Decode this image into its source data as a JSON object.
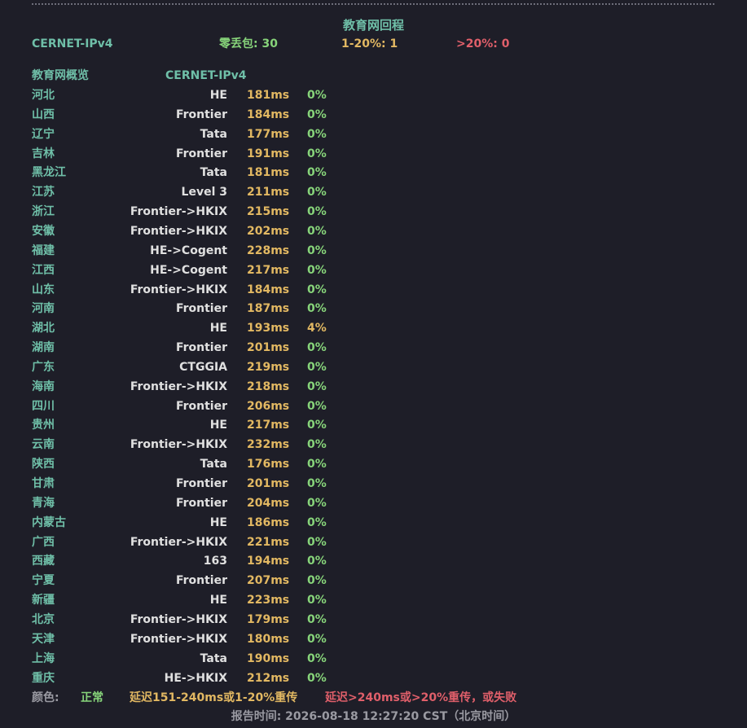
{
  "title": "教育网回程",
  "summary": {
    "network": "CERNET-IPv4",
    "zero_loss_label": "零丢包: 30",
    "mid_loss_label": "1-20%:  1",
    "high_loss_label": ">20%:  0"
  },
  "table": {
    "header_region": "教育网概览",
    "header_network": "CERNET-IPv4",
    "rows": [
      {
        "province": "河北",
        "isp": "HE",
        "latency": "181ms",
        "loss": "0%",
        "status": "normal"
      },
      {
        "province": "山西",
        "isp": "Frontier",
        "latency": "184ms",
        "loss": "0%",
        "status": "normal"
      },
      {
        "province": "辽宁",
        "isp": "Tata",
        "latency": "177ms",
        "loss": "0%",
        "status": "normal"
      },
      {
        "province": "吉林",
        "isp": "Frontier",
        "latency": "191ms",
        "loss": "0%",
        "status": "normal"
      },
      {
        "province": "黑龙江",
        "isp": "Tata",
        "latency": "181ms",
        "loss": "0%",
        "status": "normal"
      },
      {
        "province": "江苏",
        "isp": "Level 3",
        "latency": "211ms",
        "loss": "0%",
        "status": "normal"
      },
      {
        "province": "浙江",
        "isp": "Frontier->HKIX",
        "latency": "215ms",
        "loss": "0%",
        "status": "normal"
      },
      {
        "province": "安徽",
        "isp": "Frontier->HKIX",
        "latency": "202ms",
        "loss": "0%",
        "status": "normal"
      },
      {
        "province": "福建",
        "isp": "HE->Cogent",
        "latency": "228ms",
        "loss": "0%",
        "status": "normal"
      },
      {
        "province": "江西",
        "isp": "HE->Cogent",
        "latency": "217ms",
        "loss": "0%",
        "status": "normal"
      },
      {
        "province": "山东",
        "isp": "Frontier->HKIX",
        "latency": "184ms",
        "loss": "0%",
        "status": "normal"
      },
      {
        "province": "河南",
        "isp": "Frontier",
        "latency": "187ms",
        "loss": "0%",
        "status": "normal"
      },
      {
        "province": "湖北",
        "isp": "HE",
        "latency": "193ms",
        "loss": "4%",
        "status": "warn"
      },
      {
        "province": "湖南",
        "isp": "Frontier",
        "latency": "201ms",
        "loss": "0%",
        "status": "normal"
      },
      {
        "province": "广东",
        "isp": "CTGGIA",
        "latency": "219ms",
        "loss": "0%",
        "status": "normal"
      },
      {
        "province": "海南",
        "isp": "Frontier->HKIX",
        "latency": "218ms",
        "loss": "0%",
        "status": "normal"
      },
      {
        "province": "四川",
        "isp": "Frontier",
        "latency": "206ms",
        "loss": "0%",
        "status": "normal"
      },
      {
        "province": "贵州",
        "isp": "HE",
        "latency": "217ms",
        "loss": "0%",
        "status": "normal"
      },
      {
        "province": "云南",
        "isp": "Frontier->HKIX",
        "latency": "232ms",
        "loss": "0%",
        "status": "normal"
      },
      {
        "province": "陕西",
        "isp": "Tata",
        "latency": "176ms",
        "loss": "0%",
        "status": "normal"
      },
      {
        "province": "甘肃",
        "isp": "Frontier",
        "latency": "201ms",
        "loss": "0%",
        "status": "normal"
      },
      {
        "province": "青海",
        "isp": "Frontier",
        "latency": "204ms",
        "loss": "0%",
        "status": "normal"
      },
      {
        "province": "内蒙古",
        "isp": "HE",
        "latency": "186ms",
        "loss": "0%",
        "status": "normal"
      },
      {
        "province": "广西",
        "isp": "Frontier->HKIX",
        "latency": "221ms",
        "loss": "0%",
        "status": "normal"
      },
      {
        "province": "西藏",
        "isp": "163",
        "latency": "194ms",
        "loss": "0%",
        "status": "normal"
      },
      {
        "province": "宁夏",
        "isp": "Frontier",
        "latency": "207ms",
        "loss": "0%",
        "status": "normal"
      },
      {
        "province": "新疆",
        "isp": "HE",
        "latency": "223ms",
        "loss": "0%",
        "status": "normal"
      },
      {
        "province": "北京",
        "isp": "Frontier->HKIX",
        "latency": "179ms",
        "loss": "0%",
        "status": "normal"
      },
      {
        "province": "天津",
        "isp": "Frontier->HKIX",
        "latency": "180ms",
        "loss": "0%",
        "status": "normal"
      },
      {
        "province": "上海",
        "isp": "Tata",
        "latency": "190ms",
        "loss": "0%",
        "status": "normal"
      },
      {
        "province": "重庆",
        "isp": "HE->HKIX",
        "latency": "212ms",
        "loss": "0%",
        "status": "normal"
      }
    ]
  },
  "legend": {
    "label": "颜色:",
    "normal": "正常",
    "warn": "延迟151-240ms或1-20%重传",
    "bad": "延迟>240ms或>20%重传，或失败"
  },
  "footer": "报告时间:  2026-08-18 12:27:20 CST（北京时间）",
  "colors": {
    "background": "#1e1e28",
    "teal": "#6fbfa8",
    "green": "#87d47a",
    "yellow": "#e2b862",
    "red": "#e05f6a",
    "gray": "#9a9aa2"
  }
}
